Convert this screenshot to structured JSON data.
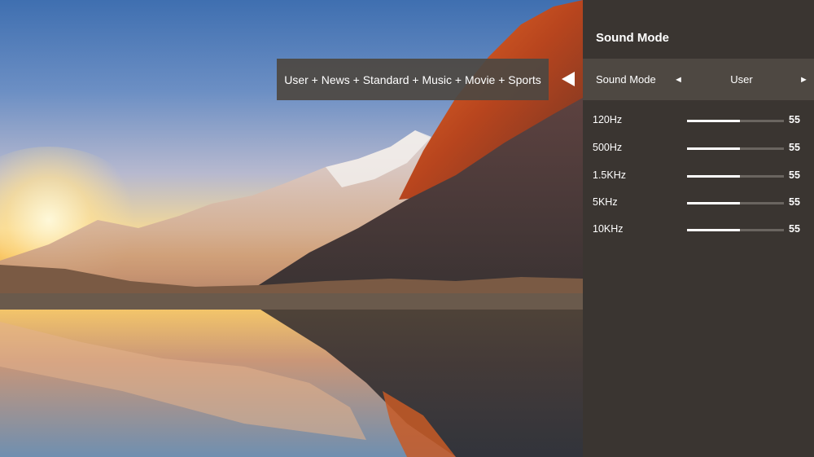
{
  "tooltip": {
    "text": "User + News + Standard +  Music + Movie + Sports",
    "pointer_icon": "triangle-left-icon"
  },
  "panel": {
    "title": "Sound Mode",
    "mode": {
      "label": "Sound Mode",
      "value": "User",
      "left_icon": "◄",
      "right_icon": "►"
    },
    "equalizer": [
      {
        "label": "120Hz",
        "value": "55",
        "level": 0.55
      },
      {
        "label": "500Hz",
        "value": "55",
        "level": 0.55
      },
      {
        "label": "1.5KHz",
        "value": "55",
        "level": 0.55
      },
      {
        "label": "5KHz",
        "value": "55",
        "level": 0.55
      },
      {
        "label": "10KHz",
        "value": "55",
        "level": 0.55
      }
    ]
  }
}
